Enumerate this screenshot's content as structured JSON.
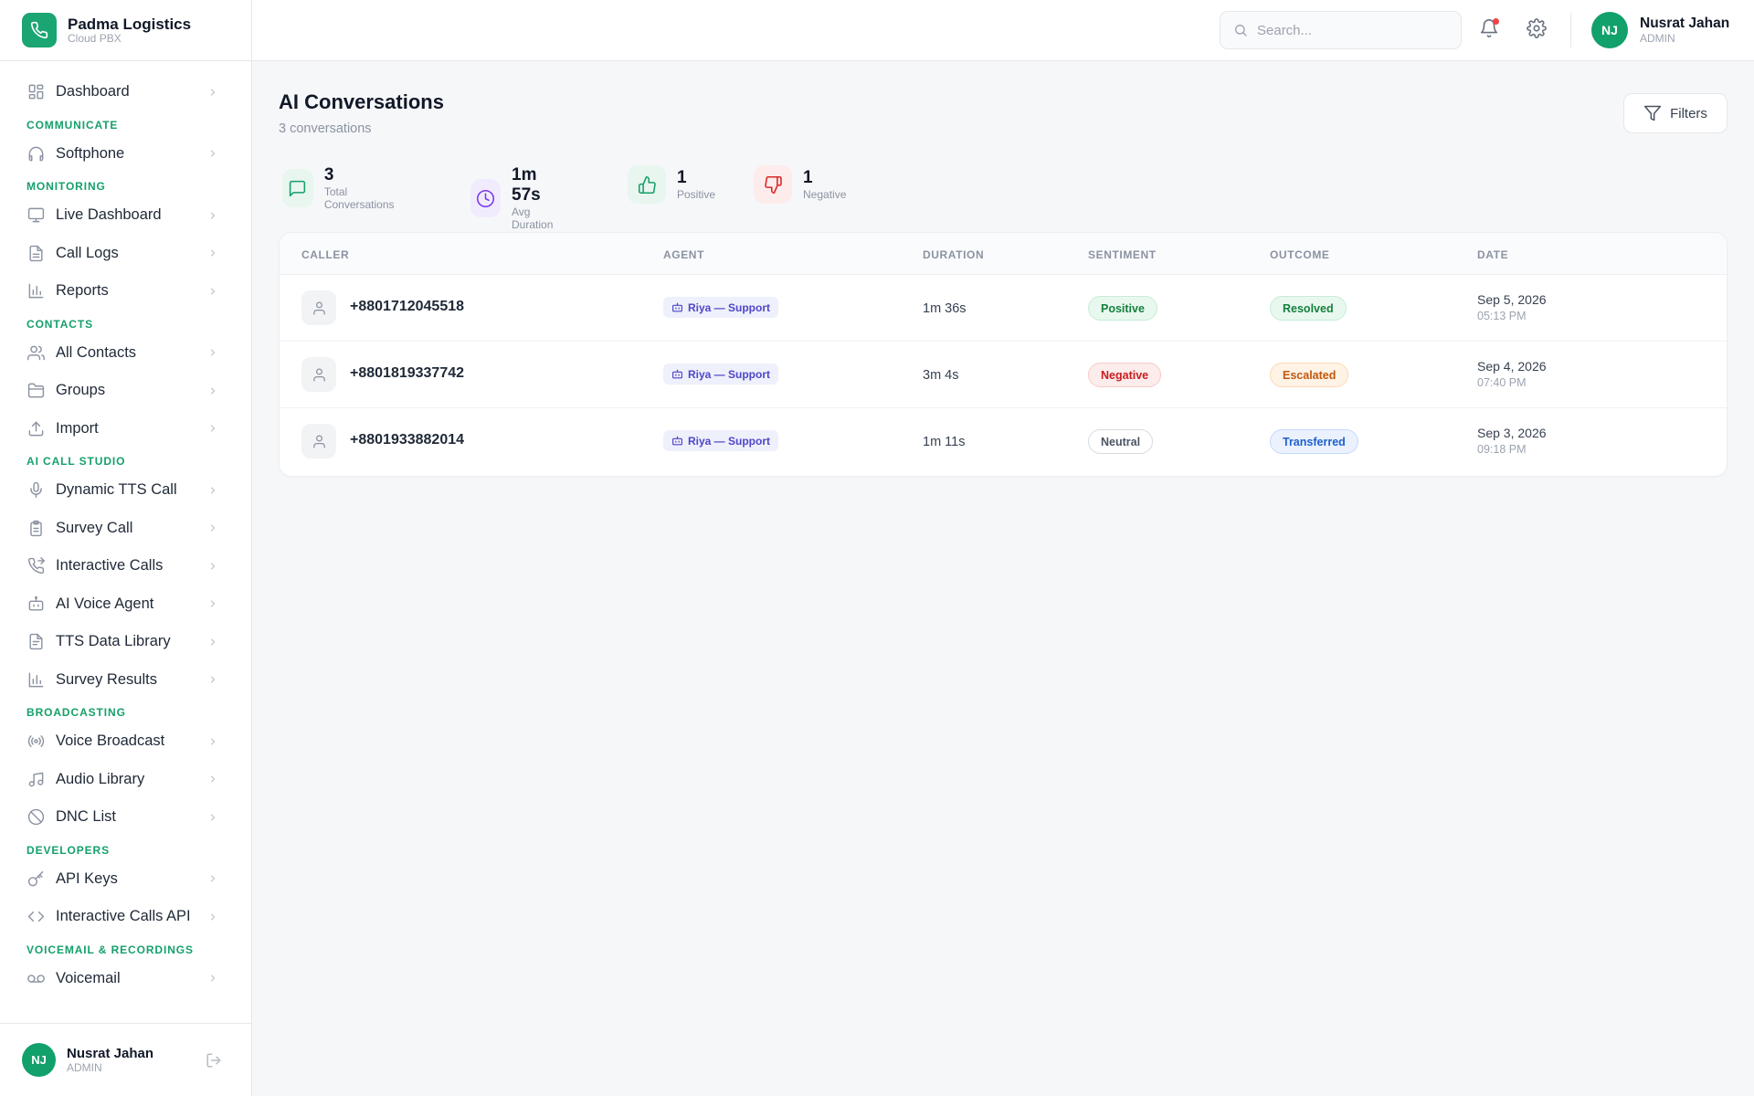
{
  "brand": {
    "name": "Padma Logistics",
    "subtitle": "Cloud PBX"
  },
  "sidebar": {
    "items": [
      {
        "type": "item",
        "label": "Dashboard",
        "icon": "dashboard-icon"
      },
      {
        "type": "section",
        "label": "COMMUNICATE"
      },
      {
        "type": "item",
        "label": "Softphone",
        "icon": "headset-icon"
      },
      {
        "type": "section",
        "label": "MONITORING"
      },
      {
        "type": "item",
        "label": "Live Dashboard",
        "icon": "monitor-icon"
      },
      {
        "type": "item",
        "label": "Call Logs",
        "icon": "document-icon"
      },
      {
        "type": "item",
        "label": "Reports",
        "icon": "bar-chart-icon"
      },
      {
        "type": "section",
        "label": "CONTACTS"
      },
      {
        "type": "item",
        "label": "All Contacts",
        "icon": "users-icon"
      },
      {
        "type": "item",
        "label": "Groups",
        "icon": "folder-icon"
      },
      {
        "type": "item",
        "label": "Import",
        "icon": "upload-icon"
      },
      {
        "type": "section",
        "label": "AI CALL STUDIO"
      },
      {
        "type": "item",
        "label": "Dynamic TTS Call",
        "icon": "microphone-icon"
      },
      {
        "type": "item",
        "label": "Survey Call",
        "icon": "clipboard-icon"
      },
      {
        "type": "item",
        "label": "Interactive Calls",
        "icon": "phone-forward-icon"
      },
      {
        "type": "item",
        "label": "AI Voice Agent",
        "icon": "robot-icon"
      },
      {
        "type": "item",
        "label": "TTS Data Library",
        "icon": "file-text-icon"
      },
      {
        "type": "item",
        "label": "Survey Results",
        "icon": "bar-chart-icon"
      },
      {
        "type": "section",
        "label": "BROADCASTING"
      },
      {
        "type": "item",
        "label": "Voice Broadcast",
        "icon": "broadcast-icon"
      },
      {
        "type": "item",
        "label": "Audio Library",
        "icon": "music-icon"
      },
      {
        "type": "item",
        "label": "DNC List",
        "icon": "ban-icon"
      },
      {
        "type": "section",
        "label": "DEVELOPERS"
      },
      {
        "type": "item",
        "label": "API Keys",
        "icon": "key-icon"
      },
      {
        "type": "item",
        "label": "Interactive Calls API",
        "icon": "code-icon"
      },
      {
        "type": "section",
        "label": "VOICEMAIL & RECORDINGS"
      },
      {
        "type": "item",
        "label": "Voicemail",
        "icon": "voicemail-icon"
      }
    ],
    "footer": {
      "initials": "NJ",
      "name": "Nusrat Jahan",
      "role": "ADMIN"
    }
  },
  "header": {
    "search_placeholder": "Search...",
    "user": {
      "initials": "NJ",
      "name": "Nusrat Jahan",
      "role": "ADMIN"
    }
  },
  "page": {
    "title": "AI Conversations",
    "subtitle": "3 conversations",
    "filters_label": "Filters"
  },
  "stats": [
    {
      "value": "3",
      "label": "Total Conversations",
      "icon": "chat-icon",
      "color": "#16a06a",
      "bg": "#e8f6ef"
    },
    {
      "value": "1m 57s",
      "label": "Avg Duration",
      "icon": "clock-icon",
      "color": "#7c3aed",
      "bg": "#f1ecfd"
    },
    {
      "value": "1",
      "label": "Positive",
      "icon": "thumbs-up-icon",
      "color": "#16a06a",
      "bg": "#e8f6ef"
    },
    {
      "value": "1",
      "label": "Negative",
      "icon": "thumbs-down-icon",
      "color": "#dc2626",
      "bg": "#fdecec"
    }
  ],
  "table": {
    "columns": [
      "CALLER",
      "AGENT",
      "DURATION",
      "SENTIMENT",
      "OUTCOME",
      "DATE"
    ],
    "rows": [
      {
        "caller": "+8801712045518",
        "agent": "Riya — Support",
        "duration": "1m 36s",
        "sentiment": "Positive",
        "outcome": "Resolved",
        "date": "Sep 5, 2026",
        "time": "05:13 PM"
      },
      {
        "caller": "+8801819337742",
        "agent": "Riya — Support",
        "duration": "3m 4s",
        "sentiment": "Negative",
        "outcome": "Escalated",
        "date": "Sep 4, 2026",
        "time": "07:40 PM"
      },
      {
        "caller": "+8801933882014",
        "agent": "Riya — Support",
        "duration": "1m 11s",
        "sentiment": "Neutral",
        "outcome": "Transferred",
        "date": "Sep 3, 2026",
        "time": "09:18 PM"
      }
    ]
  },
  "colors": {
    "accent": "#16a06a",
    "badges": {
      "Positive": {
        "fg": "#15803d",
        "bg": "#e9f8ef",
        "border": "#c5ecd4"
      },
      "Negative": {
        "fg": "#c81e1e",
        "bg": "#fdecec",
        "border": "#f7caca"
      },
      "Neutral": {
        "fg": "#4b5563",
        "bg": "#ffffff",
        "border": "#d6dae0"
      },
      "Resolved": {
        "fg": "#15803d",
        "bg": "#e9f8ef",
        "border": "#c5ecd4"
      },
      "Escalated": {
        "fg": "#c2570c",
        "bg": "#fff3e6",
        "border": "#fbd9b3"
      },
      "Transferred": {
        "fg": "#1d5fcf",
        "bg": "#ebf2fe",
        "border": "#c6d9fb"
      }
    }
  }
}
